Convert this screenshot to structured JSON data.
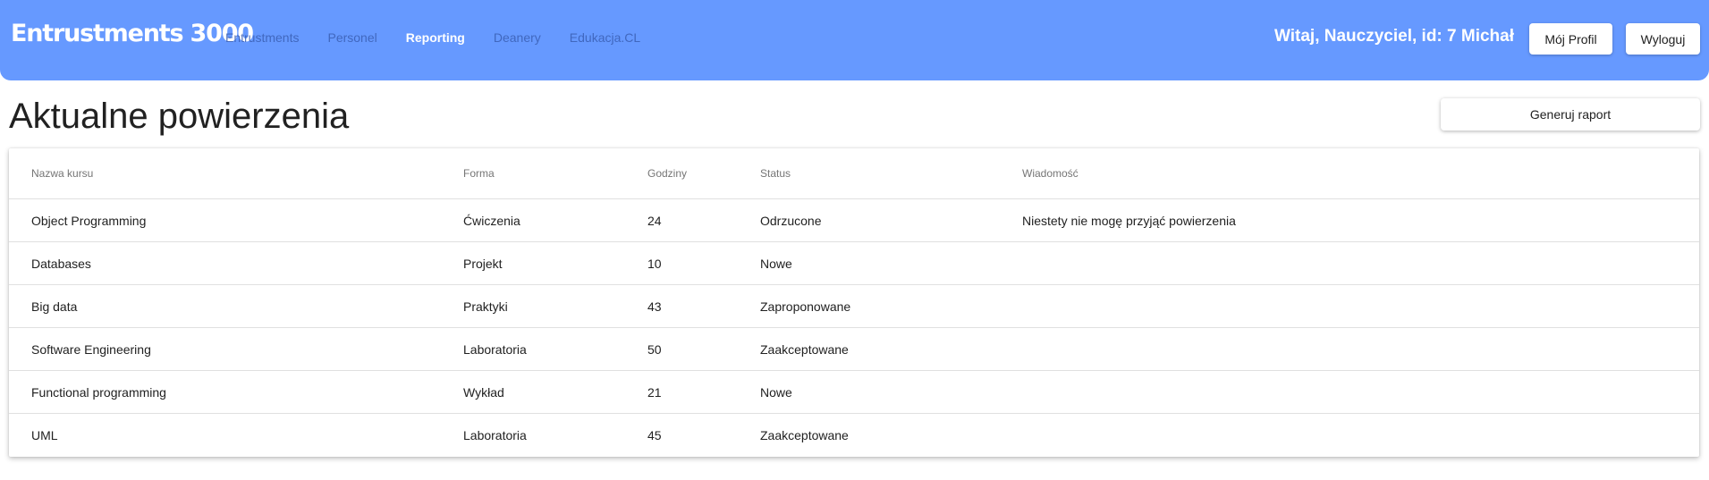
{
  "navbar": {
    "brand": "Entrustments 3000",
    "links": [
      {
        "label": "Entrustments",
        "active": false
      },
      {
        "label": "Personel",
        "active": false
      },
      {
        "label": "Reporting",
        "active": true
      },
      {
        "label": "Deanery",
        "active": false
      },
      {
        "label": "Edukacja.CL",
        "active": false
      }
    ],
    "greeting": "Witaj, Nauczyciel, id: 7 Michał",
    "profile_label": "Mój Profil",
    "logout_label": "Wyloguj",
    "background_color": "#6699ff"
  },
  "page": {
    "title": "Aktualne powierzenia",
    "report_button_label": "Generuj raport"
  },
  "table": {
    "headers": [
      "Nazwa kursu",
      "Forma",
      "Godziny",
      "Status",
      "Wiadomość"
    ],
    "rows": [
      {
        "course": "Object Programming",
        "form": "Ćwiczenia",
        "hours": "24",
        "status": "Odrzucone",
        "message": "Niestety nie mogę przyjąć powierzenia"
      },
      {
        "course": "Databases",
        "form": "Projekt",
        "hours": "10",
        "status": "Nowe",
        "message": ""
      },
      {
        "course": "Big data",
        "form": "Praktyki",
        "hours": "43",
        "status": "Zaproponowane",
        "message": ""
      },
      {
        "course": "Software Engineering",
        "form": "Laboratoria",
        "hours": "50",
        "status": "Zaakceptowane",
        "message": ""
      },
      {
        "course": "Functional programming",
        "form": "Wykład",
        "hours": "21",
        "status": "Nowe",
        "message": ""
      },
      {
        "course": "UML",
        "form": "Laboratoria",
        "hours": "45",
        "status": "Zaakceptowane",
        "message": ""
      }
    ]
  }
}
